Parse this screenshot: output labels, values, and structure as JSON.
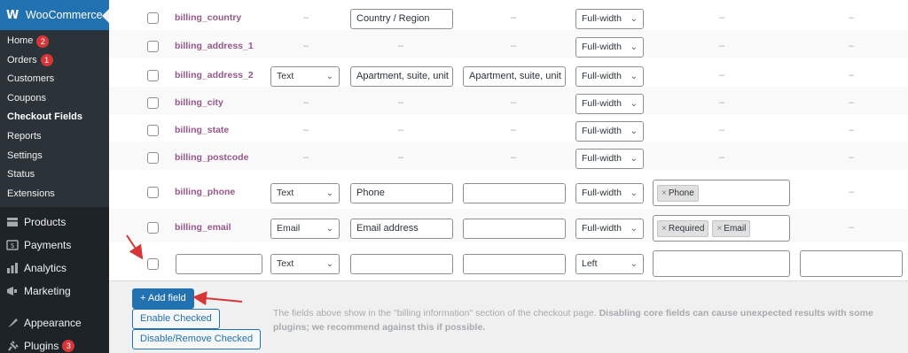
{
  "sidebar": {
    "header": {
      "logo": "W",
      "title": "WooCommerce"
    },
    "submenu": [
      {
        "label": "Home",
        "badge": "2"
      },
      {
        "label": "Orders",
        "badge": "1"
      },
      {
        "label": "Customers"
      },
      {
        "label": "Coupons"
      },
      {
        "label": "Checkout Fields",
        "current": true
      },
      {
        "label": "Reports"
      },
      {
        "label": "Settings"
      },
      {
        "label": "Status"
      },
      {
        "label": "Extensions"
      }
    ],
    "menu": [
      {
        "label": "Products",
        "icon": "products-icon"
      },
      {
        "label": "Payments",
        "icon": "payments-icon"
      },
      {
        "label": "Analytics",
        "icon": "analytics-icon"
      },
      {
        "label": "Marketing",
        "icon": "marketing-icon"
      },
      {
        "label": "Appearance",
        "icon": "appearance-icon"
      },
      {
        "label": "Plugins",
        "icon": "plugins-icon",
        "badge": "3"
      }
    ]
  },
  "dash": "–",
  "fields": [
    {
      "name": "billing_country",
      "type": "",
      "label": "Country / Region",
      "placeholder": "",
      "position": "Full-width",
      "validation": []
    },
    {
      "name": "billing_address_1",
      "type": "",
      "label": "",
      "placeholder": "",
      "position": "Full-width",
      "validation": []
    },
    {
      "name": "billing_address_2",
      "type": "Text",
      "label": "Apartment, suite, unit",
      "placeholder": "Apartment, suite, unit",
      "position": "Full-width",
      "validation": []
    },
    {
      "name": "billing_city",
      "type": "",
      "label": "",
      "placeholder": "",
      "position": "Full-width",
      "validation": []
    },
    {
      "name": "billing_state",
      "type": "",
      "label": "",
      "placeholder": "",
      "position": "Full-width",
      "validation": []
    },
    {
      "name": "billing_postcode",
      "type": "",
      "label": "",
      "placeholder": "",
      "position": "Full-width",
      "validation": []
    },
    {
      "name": "billing_phone",
      "type": "Text",
      "label": "Phone",
      "placeholder": "",
      "position": "Full-width",
      "validation": [
        "Phone"
      ]
    },
    {
      "name": "billing_email",
      "type": "Email",
      "label": "Email address",
      "placeholder": "",
      "position": "Full-width",
      "validation": [
        "Required",
        "Email"
      ]
    }
  ],
  "new_row": {
    "type": "Text",
    "position": "Left"
  },
  "buttons": {
    "add_field": "+ Add field",
    "enable_checked": "Enable Checked",
    "disable_remove": "Disable/Remove Checked"
  },
  "note": {
    "text": "The fields above show in the \"billing information\" section of the checkout page. ",
    "bold": "Disabling core fields can cause unexpected results with some plugins; we recommend against this if possible."
  },
  "colors": {
    "accent": "#2271b1",
    "sidebar": "#1d2327",
    "field_name": "#96588a",
    "arrow": "#d63638"
  }
}
